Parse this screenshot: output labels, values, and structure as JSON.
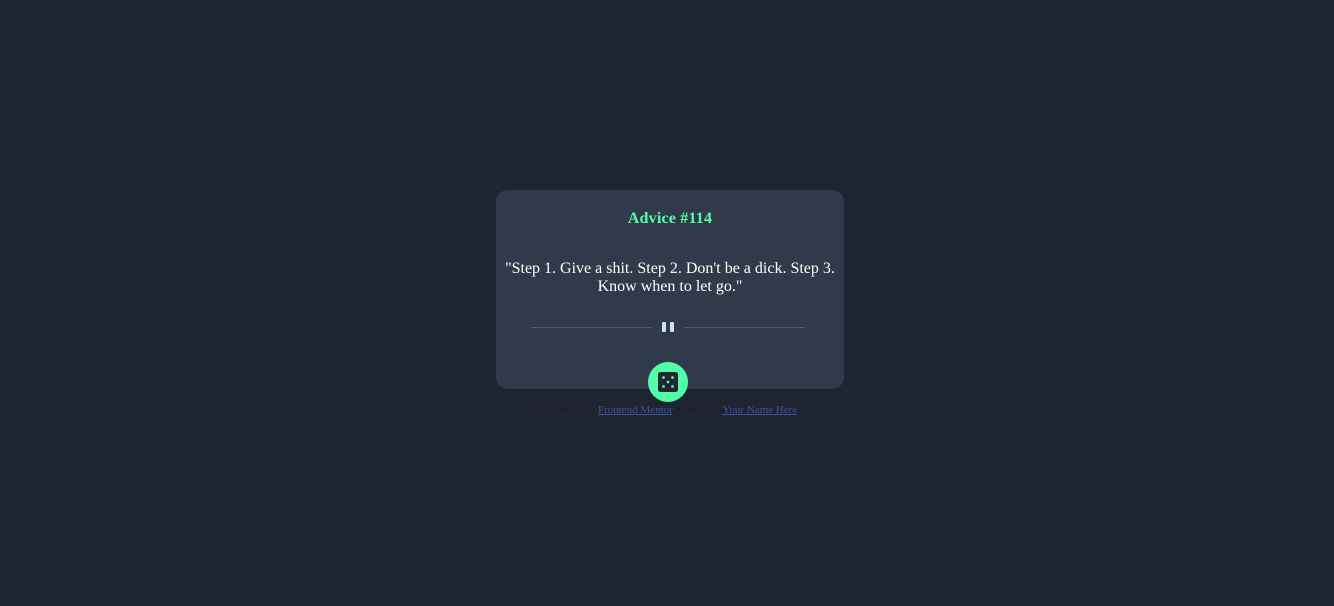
{
  "card": {
    "advice_id": "Advice #114",
    "advice_text": "\"Step 1. Give a shit. Step 2. Don't be a dick. Step 3. Know when to let go.\""
  },
  "divider": {
    "icon": "pause-icon"
  },
  "dice_button": {
    "icon": "dice-icon"
  },
  "attribution": {
    "prefix": "Challenge by ",
    "challenge_link": "Frontend Mentor",
    "middle": ". Coded by ",
    "author_link": "Your Name Here",
    "link_color": "#3e52a3"
  },
  "colors": {
    "background": "#1f2431",
    "card": "#313a4a",
    "accent": "#52ffa8",
    "text": "#ffffff",
    "divider": "#4e5d73"
  }
}
